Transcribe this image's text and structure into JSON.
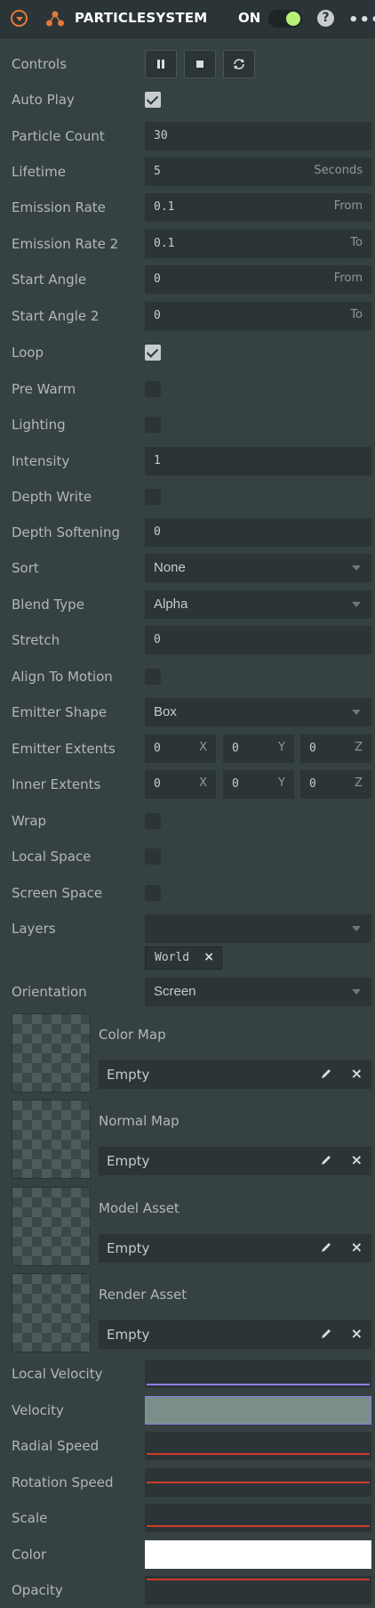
{
  "header": {
    "title": "PARTICLESYSTEM",
    "on_label": "ON",
    "help_label": "?",
    "more_label": "•••",
    "icons": {
      "collapse": "chevron-down-circle-icon",
      "component": "particle-system-icon",
      "help": "help-icon",
      "more": "more-icon"
    },
    "accent_color": "#e0793a",
    "toggle_color": "#b6f27a"
  },
  "controls": {
    "label": "Controls",
    "buttons": [
      "pause-icon",
      "stop-icon",
      "refresh-icon"
    ]
  },
  "fields": {
    "auto_play": {
      "label": "Auto Play",
      "checked": true
    },
    "particle_count": {
      "label": "Particle Count",
      "value": "30"
    },
    "lifetime": {
      "label": "Lifetime",
      "value": "5",
      "suffix": "Seconds"
    },
    "emission_rate": {
      "label": "Emission Rate",
      "value": "0.1",
      "suffix": "From"
    },
    "emission_rate2": {
      "label": "Emission Rate 2",
      "value": "0.1",
      "suffix": "To"
    },
    "start_angle": {
      "label": "Start Angle",
      "value": "0",
      "suffix": "From"
    },
    "start_angle2": {
      "label": "Start Angle 2",
      "value": "0",
      "suffix": "To"
    },
    "loop": {
      "label": "Loop",
      "checked": true
    },
    "pre_warm": {
      "label": "Pre Warm",
      "checked": false
    },
    "lighting": {
      "label": "Lighting",
      "checked": false
    },
    "intensity": {
      "label": "Intensity",
      "value": "1"
    },
    "depth_write": {
      "label": "Depth Write",
      "checked": false
    },
    "depth_softening": {
      "label": "Depth Softening",
      "value": "0"
    },
    "sort": {
      "label": "Sort",
      "value": "None"
    },
    "blend_type": {
      "label": "Blend Type",
      "value": "Alpha"
    },
    "stretch": {
      "label": "Stretch",
      "value": "0"
    },
    "align_to_motion": {
      "label": "Align To Motion",
      "checked": false
    },
    "emitter_shape": {
      "label": "Emitter Shape",
      "value": "Box"
    },
    "emitter_extents": {
      "label": "Emitter Extents",
      "x": "0",
      "y": "0",
      "z": "0",
      "ax_x": "X",
      "ax_y": "Y",
      "ax_z": "Z"
    },
    "inner_extents": {
      "label": "Inner Extents",
      "x": "0",
      "y": "0",
      "z": "0",
      "ax_x": "X",
      "ax_y": "Y",
      "ax_z": "Z"
    },
    "wrap": {
      "label": "Wrap",
      "checked": false
    },
    "local_space": {
      "label": "Local Space",
      "checked": false
    },
    "screen_space": {
      "label": "Screen Space",
      "checked": false
    },
    "layers": {
      "label": "Layers",
      "value": "",
      "tag": "World",
      "tag_close": "×"
    },
    "orientation": {
      "label": "Orientation",
      "value": "Screen"
    }
  },
  "assets": [
    {
      "label": "Color Map",
      "value": "Empty",
      "close": "×"
    },
    {
      "label": "Normal Map",
      "value": "Empty",
      "close": "×"
    },
    {
      "label": "Model Asset",
      "value": "Empty",
      "close": "×"
    },
    {
      "label": "Render Asset",
      "value": "Empty",
      "close": "×"
    }
  ],
  "curves": {
    "local_velocity": {
      "label": "Local Velocity",
      "color": "#8e7de6"
    },
    "velocity": {
      "label": "Velocity",
      "color": "#7a8f8a"
    },
    "radial_speed": {
      "label": "Radial Speed",
      "color": "#d13a2a"
    },
    "rotation_speed": {
      "label": "Rotation Speed",
      "color": "#d13a2a"
    },
    "scale": {
      "label": "Scale",
      "color": "#d13a2a"
    },
    "color": {
      "label": "Color",
      "color": "#ffffff"
    },
    "opacity": {
      "label": "Opacity",
      "color": "#d13a2a"
    }
  }
}
